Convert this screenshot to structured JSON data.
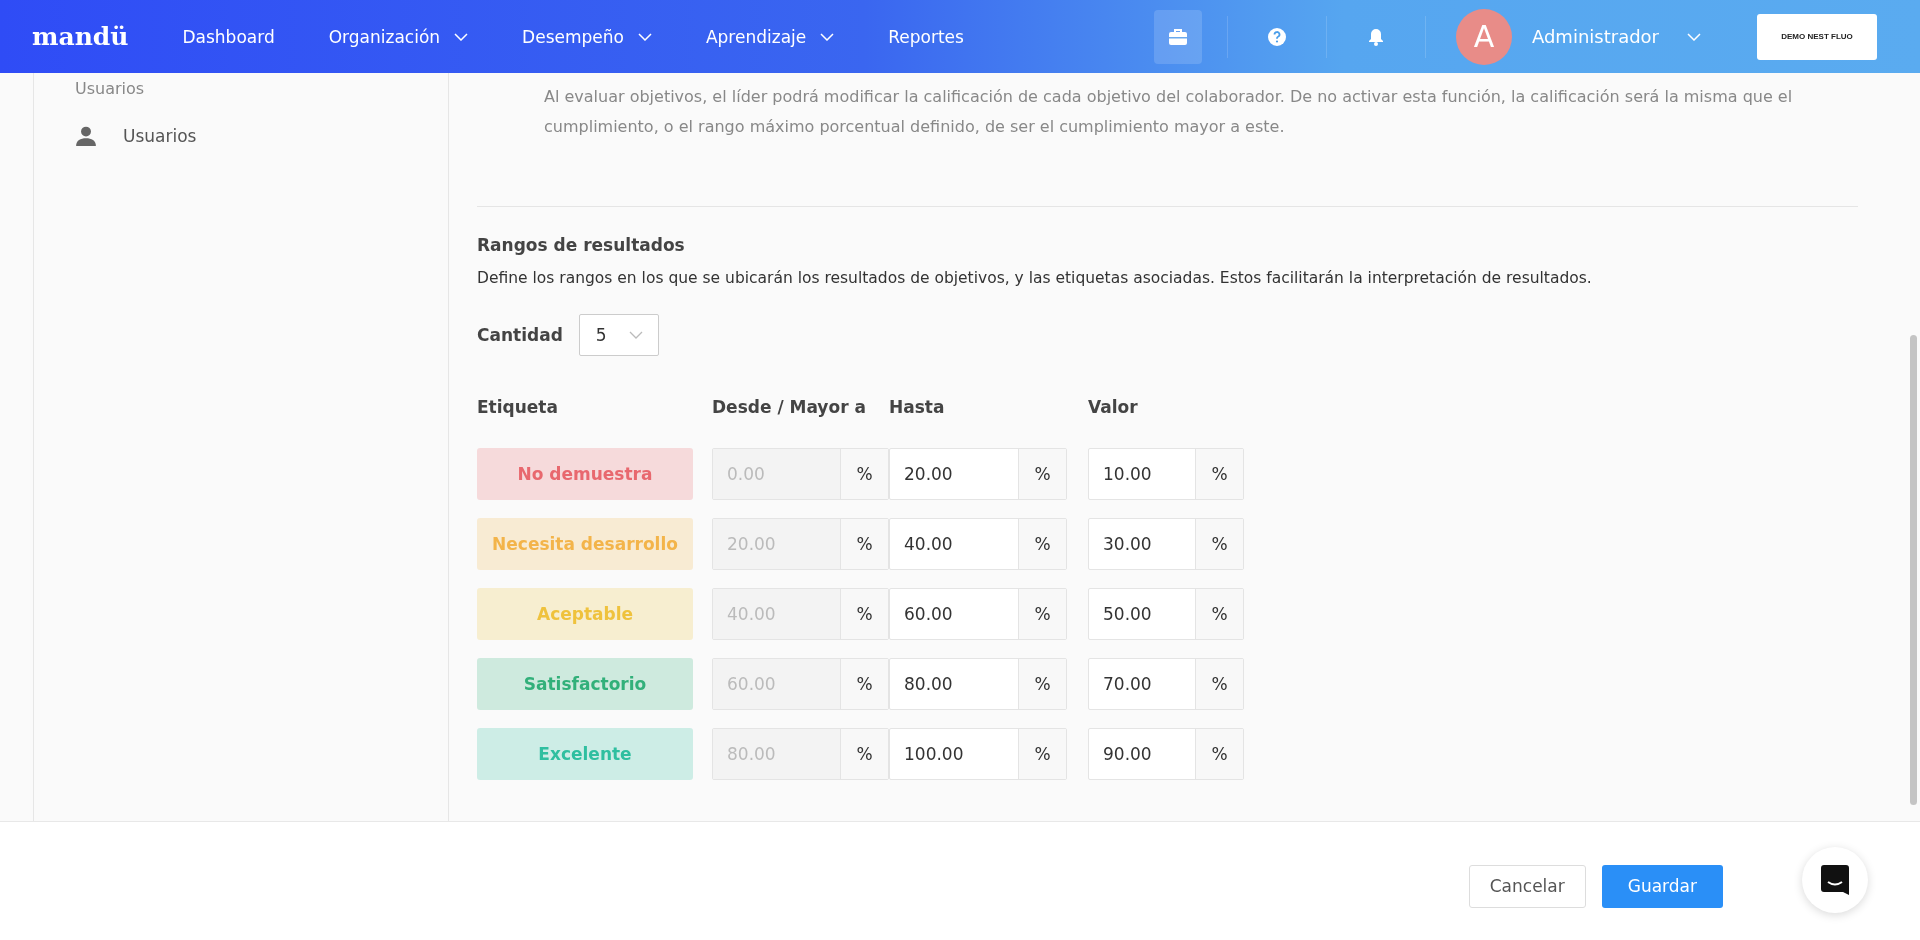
{
  "nav": {
    "logo": "mandü",
    "items": [
      {
        "label": "Dashboard",
        "dropdown": false
      },
      {
        "label": "Organización",
        "dropdown": true
      },
      {
        "label": "Desempeño",
        "dropdown": true
      },
      {
        "label": "Aprendizaje",
        "dropdown": true
      },
      {
        "label": "Reportes",
        "dropdown": false
      }
    ],
    "user": {
      "initial": "A",
      "name": "Administrador"
    },
    "company_button": "DEMO NEST FLUO"
  },
  "sidebar": {
    "heading": "Usuarios",
    "items": [
      {
        "label": "Usuarios"
      }
    ]
  },
  "rating_option": {
    "description": "Al evaluar objetivos, el líder podrá modificar la calificación de cada objetivo del colaborador. De no activar esta función, la calificación será la misma que el cumplimiento, o el rango máximo porcentual definido, de ser el cumplimiento mayor a este."
  },
  "ranges": {
    "title": "Rangos de resultados",
    "description": "Define los rangos en los que se ubicarán los resultados de objetivos, y las etiquetas asociadas. Estos facilitarán la interpretación de resultados.",
    "quantity_label": "Cantidad",
    "quantity": "5",
    "columns": [
      "Etiqueta",
      "Desde / Mayor a",
      "Hasta",
      "Valor"
    ],
    "rows": [
      {
        "label": "No demuestra",
        "color": "#e8686e",
        "from": "0.00",
        "to": "20.00",
        "value": "10.00",
        "unit": "%"
      },
      {
        "label": "Necesita desarrollo",
        "color": "#f3b44a",
        "from": "20.00",
        "to": "40.00",
        "value": "30.00",
        "unit": "%"
      },
      {
        "label": "Aceptable",
        "color": "#efc23d",
        "from": "40.00",
        "to": "60.00",
        "value": "50.00",
        "unit": "%"
      },
      {
        "label": "Satisfactorio",
        "color": "#32b07a",
        "from": "60.00",
        "to": "80.00",
        "value": "70.00",
        "unit": "%"
      },
      {
        "label": "Excelente",
        "color": "#2fbfa0",
        "from": "80.00",
        "to": "100.00",
        "value": "90.00",
        "unit": "%"
      }
    ]
  },
  "footer": {
    "buttons": [
      {
        "label": "Cancelar",
        "kind": "secondary"
      },
      {
        "label": "Guardar",
        "kind": "primary"
      }
    ]
  }
}
